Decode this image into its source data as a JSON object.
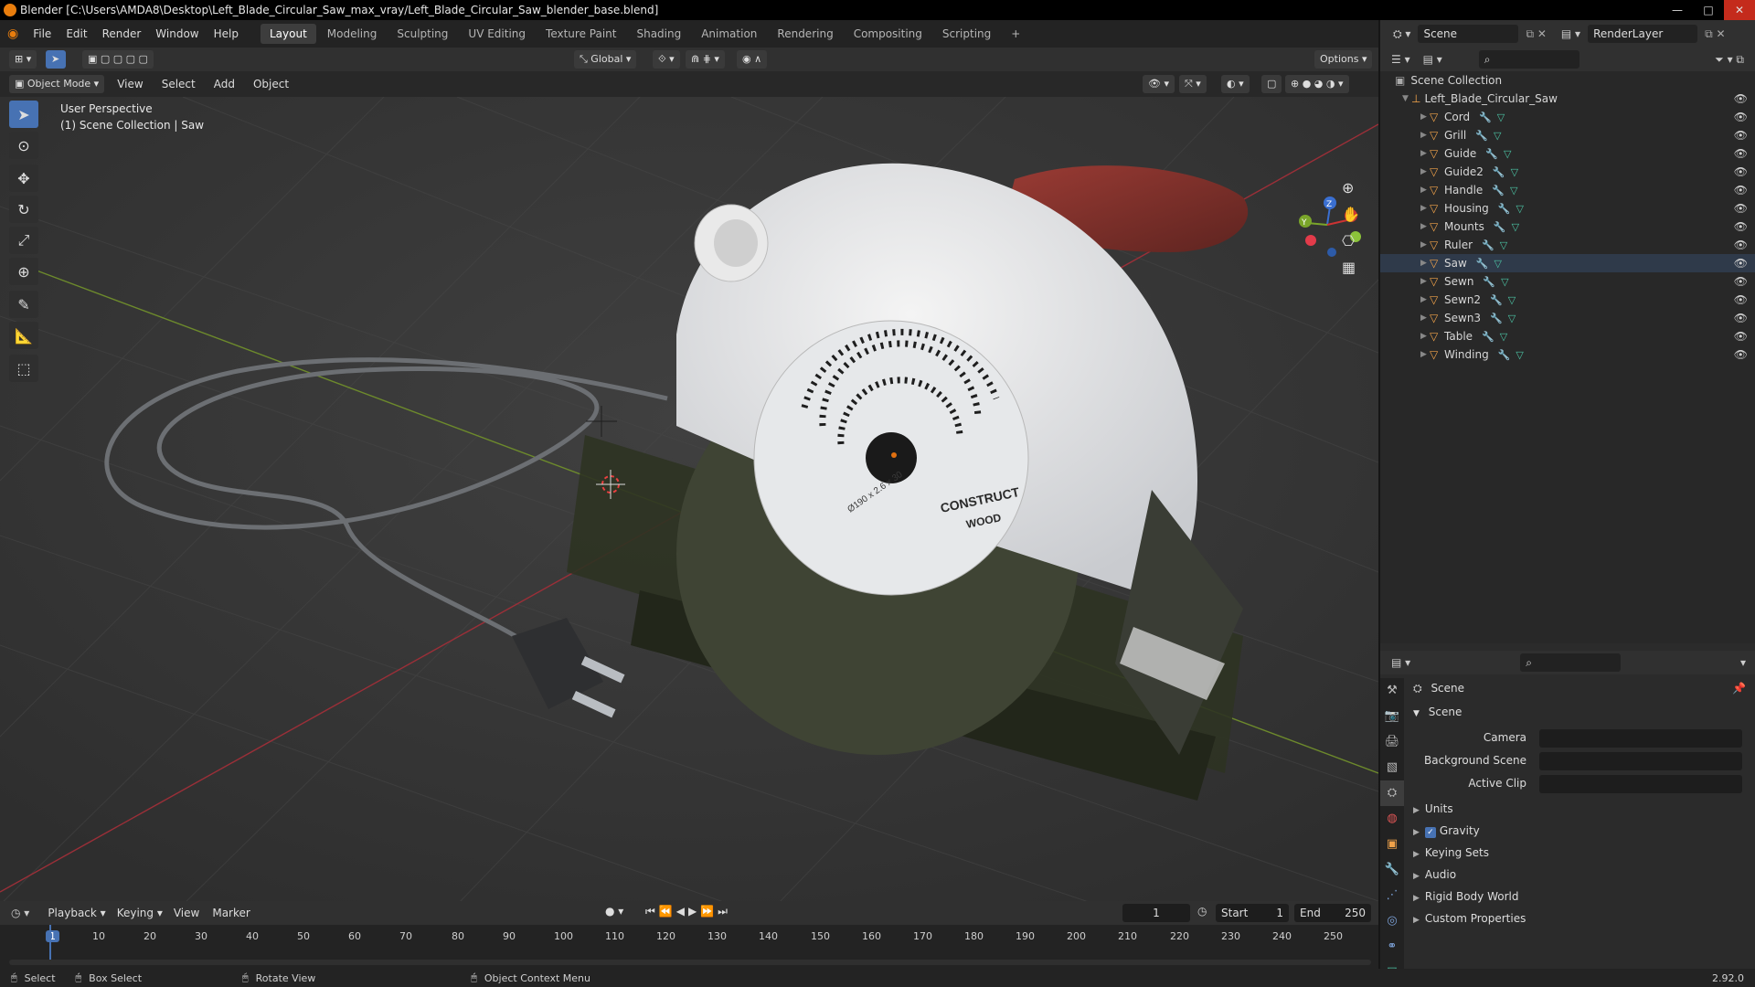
{
  "window": {
    "title": "Blender [C:\\Users\\AMDA8\\Desktop\\Left_Blade_Circular_Saw_max_vray/Left_Blade_Circular_Saw_blender_base.blend]",
    "controls": [
      "—",
      "□",
      "✕"
    ]
  },
  "menu": [
    "File",
    "Edit",
    "Render",
    "Window",
    "Help"
  ],
  "workspaces": [
    "Layout",
    "Modeling",
    "Sculpting",
    "UV Editing",
    "Texture Paint",
    "Shading",
    "Animation",
    "Rendering",
    "Compositing",
    "Scripting",
    "+"
  ],
  "active_workspace": "Layout",
  "scene_selector": {
    "label": "Scene",
    "renderlayer": "RenderLayer"
  },
  "viewport_header": {
    "transform_orientation": "Global",
    "options": "Options",
    "mode": "Object Mode",
    "menus": [
      "View",
      "Select",
      "Add",
      "Object"
    ]
  },
  "viewport": {
    "perspective": "User Perspective",
    "collection_info": "(1) Scene Collection | Saw",
    "logo_line1": "CONSTRUCT",
    "logo_line2": "WOOD",
    "blade_text": "Ø190 x 2.6 x 30",
    "gizmo": {
      "x": "X",
      "y": "Y",
      "z": "Z"
    }
  },
  "outliner": {
    "root": "Scene Collection",
    "collection": "Left_Blade_Circular_Saw",
    "objects": [
      "Cord",
      "Grill",
      "Guide",
      "Guide2",
      "Handle",
      "Housing",
      "Mounts",
      "Ruler",
      "Saw",
      "Sewn",
      "Sewn2",
      "Sewn3",
      "Table",
      "Winding"
    ],
    "active_object": "Saw"
  },
  "properties": {
    "context": "Scene",
    "section": "Scene",
    "fields": [
      {
        "label": "Camera",
        "value": ""
      },
      {
        "label": "Background Scene",
        "value": ""
      },
      {
        "label": "Active Clip",
        "value": ""
      }
    ],
    "panels": [
      {
        "label": "Units",
        "checkbox": false
      },
      {
        "label": "Gravity",
        "checkbox": true
      },
      {
        "label": "Keying Sets",
        "checkbox": false
      },
      {
        "label": "Audio",
        "checkbox": false
      },
      {
        "label": "Rigid Body World",
        "checkbox": false
      },
      {
        "label": "Custom Properties",
        "checkbox": false
      }
    ]
  },
  "timeline": {
    "menus": [
      "Playback",
      "Keying",
      "View",
      "Marker"
    ],
    "current_frame": "1",
    "start_label": "Start",
    "start": "1",
    "end_label": "End",
    "end": "250",
    "ticks": [
      "1",
      "10",
      "20",
      "30",
      "40",
      "50",
      "60",
      "70",
      "80",
      "90",
      "100",
      "110",
      "120",
      "130",
      "140",
      "150",
      "160",
      "170",
      "180",
      "190",
      "200",
      "210",
      "220",
      "230",
      "240",
      "250"
    ]
  },
  "statusbar": {
    "select": "Select",
    "box_select": "Box Select",
    "rotate_view": "Rotate View",
    "context_menu": "Object Context Menu",
    "version": "2.92.0"
  },
  "colors": {
    "accent": "#4772b3",
    "object_icon": "#f0a24a",
    "x_axis": "#b8353f",
    "y_axis": "#7da12b"
  }
}
